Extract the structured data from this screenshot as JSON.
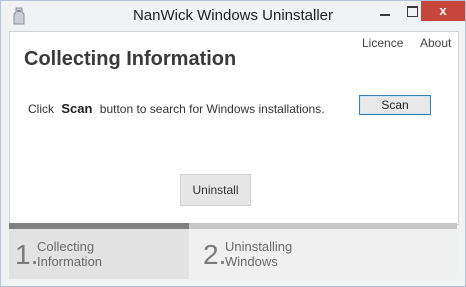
{
  "window": {
    "title": "NanWick Windows Uninstaller",
    "close_label": "x"
  },
  "header": {
    "licence_link": "Licence",
    "about_link": "About",
    "heading": "Collecting Information"
  },
  "main": {
    "instruction_prefix": "Click",
    "instruction_keyword": "Scan",
    "instruction_suffix": "button to search for Windows installations.",
    "scan_button": "Scan",
    "uninstall_button": "Uninstall"
  },
  "steps": [
    {
      "number": "1.",
      "line1": "Collecting",
      "line2": "Information",
      "active": true
    },
    {
      "number": "2.",
      "line1": "Uninstalling",
      "line2": "Windows",
      "active": false
    }
  ]
}
